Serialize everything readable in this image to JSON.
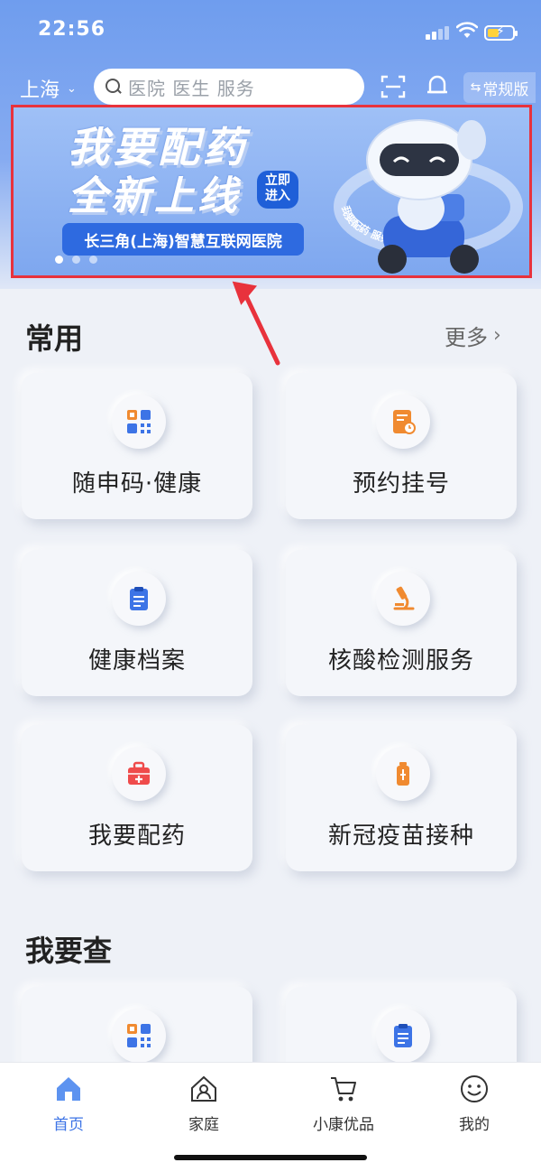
{
  "status_bar": {
    "time": "22:56"
  },
  "header": {
    "city": "上海",
    "search_placeholder": "医院 医生 服务",
    "mode_label": "常规版"
  },
  "banner": {
    "title_line1": "我要配药",
    "title_line2": "全新上线",
    "enter_badge_line1": "立即",
    "enter_badge_line2": "进入",
    "hospital_name": "长三角(上海)智慧互联网医院",
    "robot_ring_text": "我要配药 服务全新上线"
  },
  "common": {
    "title": "常用",
    "more_label": "更多",
    "items": [
      {
        "label": "随申码·健康",
        "icon": "qr-code-icon"
      },
      {
        "label": "预约挂号",
        "icon": "appointment-icon"
      },
      {
        "label": "健康档案",
        "icon": "clipboard-icon"
      },
      {
        "label": "核酸检测服务",
        "icon": "microscope-icon"
      },
      {
        "label": "我要配药",
        "icon": "medicine-box-icon"
      },
      {
        "label": "新冠疫苗接种",
        "icon": "vaccine-icon"
      }
    ]
  },
  "query": {
    "title": "我要查",
    "items": [
      {
        "label": "",
        "icon": "qr-code-icon"
      },
      {
        "label": "",
        "icon": "clipboard-icon"
      }
    ]
  },
  "tabbar": {
    "items": [
      {
        "label": "首页",
        "icon": "home-icon",
        "active": true
      },
      {
        "label": "家庭",
        "icon": "family-icon",
        "active": false
      },
      {
        "label": "小康优品",
        "icon": "cart-icon",
        "active": false
      },
      {
        "label": "我的",
        "icon": "smiley-icon",
        "active": false
      }
    ]
  },
  "colors": {
    "accent": "#3d74e6",
    "highlight_border": "#e8323c",
    "icon_orange": "#f08a30",
    "icon_blue": "#3d74e6",
    "icon_red": "#ef4b4b"
  }
}
